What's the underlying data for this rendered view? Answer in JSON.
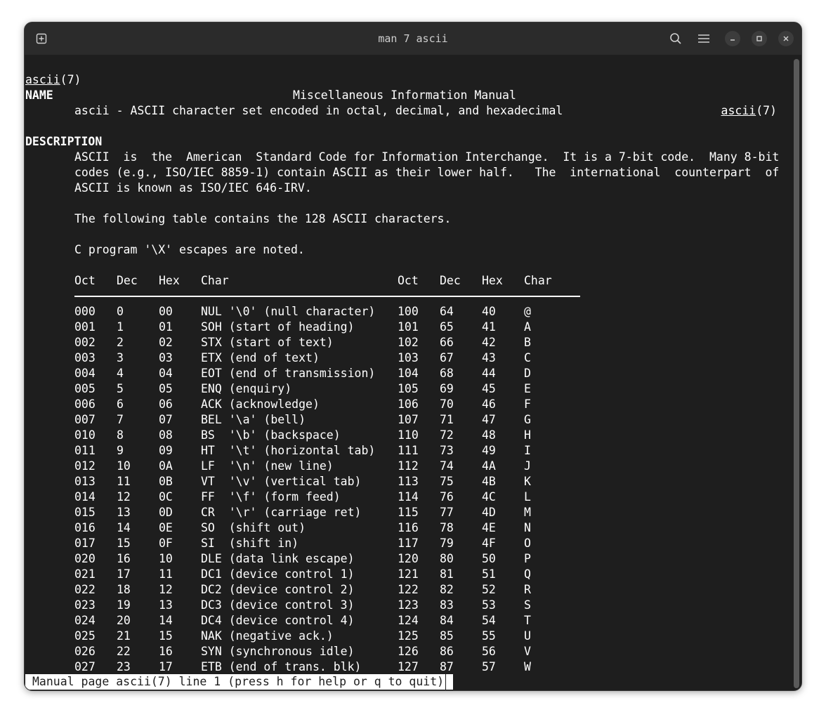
{
  "window": {
    "title": "man 7 ascii"
  },
  "titlebar": {
    "new_tab_icon": "new-tab-icon",
    "search_icon": "search-icon",
    "menu_icon": "hamburger-menu-icon",
    "minimize_icon": "minimize-icon",
    "maximize_icon": "maximize-icon",
    "close_icon": "close-icon"
  },
  "man": {
    "header_left": "ascii",
    "header_left_suffix": "(7)",
    "header_center": "Miscellaneous Information Manual",
    "header_right": "ascii",
    "header_right_suffix": "(7)",
    "name_heading": "NAME",
    "name_text": "ascii - ASCII character set encoded in octal, decimal, and hexadecimal",
    "description_heading": "DESCRIPTION",
    "desc_line1": "ASCII  is  the  American  Standard Code for Information Interchange.  It is a 7-bit code.  Many 8-bit",
    "desc_line2": "codes (e.g., ISO/IEC 8859-1) contain ASCII as their lower half.   The  international  counterpart  of",
    "desc_line3": "ASCII is known as ISO/IEC 646-IRV.",
    "table_intro": "The following table contains the 128 ASCII characters.",
    "escapes_note": "C program '\\X' escapes are noted."
  },
  "table": {
    "headers": [
      "Oct",
      "Dec",
      "Hex",
      "Char",
      "Oct",
      "Dec",
      "Hex",
      "Char"
    ],
    "rows": [
      [
        "000",
        "0",
        "00",
        "NUL '\\0' (null character)",
        "100",
        "64",
        "40",
        "@"
      ],
      [
        "001",
        "1",
        "01",
        "SOH (start of heading)",
        "101",
        "65",
        "41",
        "A"
      ],
      [
        "002",
        "2",
        "02",
        "STX (start of text)",
        "102",
        "66",
        "42",
        "B"
      ],
      [
        "003",
        "3",
        "03",
        "ETX (end of text)",
        "103",
        "67",
        "43",
        "C"
      ],
      [
        "004",
        "4",
        "04",
        "EOT (end of transmission)",
        "104",
        "68",
        "44",
        "D"
      ],
      [
        "005",
        "5",
        "05",
        "ENQ (enquiry)",
        "105",
        "69",
        "45",
        "E"
      ],
      [
        "006",
        "6",
        "06",
        "ACK (acknowledge)",
        "106",
        "70",
        "46",
        "F"
      ],
      [
        "007",
        "7",
        "07",
        "BEL '\\a' (bell)",
        "107",
        "71",
        "47",
        "G"
      ],
      [
        "010",
        "8",
        "08",
        "BS  '\\b' (backspace)",
        "110",
        "72",
        "48",
        "H"
      ],
      [
        "011",
        "9",
        "09",
        "HT  '\\t' (horizontal tab)",
        "111",
        "73",
        "49",
        "I"
      ],
      [
        "012",
        "10",
        "0A",
        "LF  '\\n' (new line)",
        "112",
        "74",
        "4A",
        "J"
      ],
      [
        "013",
        "11",
        "0B",
        "VT  '\\v' (vertical tab)",
        "113",
        "75",
        "4B",
        "K"
      ],
      [
        "014",
        "12",
        "0C",
        "FF  '\\f' (form feed)",
        "114",
        "76",
        "4C",
        "L"
      ],
      [
        "015",
        "13",
        "0D",
        "CR  '\\r' (carriage ret)",
        "115",
        "77",
        "4D",
        "M"
      ],
      [
        "016",
        "14",
        "0E",
        "SO  (shift out)",
        "116",
        "78",
        "4E",
        "N"
      ],
      [
        "017",
        "15",
        "0F",
        "SI  (shift in)",
        "117",
        "79",
        "4F",
        "O"
      ],
      [
        "020",
        "16",
        "10",
        "DLE (data link escape)",
        "120",
        "80",
        "50",
        "P"
      ],
      [
        "021",
        "17",
        "11",
        "DC1 (device control 1)",
        "121",
        "81",
        "51",
        "Q"
      ],
      [
        "022",
        "18",
        "12",
        "DC2 (device control 2)",
        "122",
        "82",
        "52",
        "R"
      ],
      [
        "023",
        "19",
        "13",
        "DC3 (device control 3)",
        "123",
        "83",
        "53",
        "S"
      ],
      [
        "024",
        "20",
        "14",
        "DC4 (device control 4)",
        "124",
        "84",
        "54",
        "T"
      ],
      [
        "025",
        "21",
        "15",
        "NAK (negative ack.)",
        "125",
        "85",
        "55",
        "U"
      ],
      [
        "026",
        "22",
        "16",
        "SYN (synchronous idle)",
        "126",
        "86",
        "56",
        "V"
      ],
      [
        "027",
        "23",
        "17",
        "ETB (end of trans. blk)",
        "127",
        "87",
        "57",
        "W"
      ]
    ]
  },
  "status": {
    "prompt": "Manual page ascii(7) line 1 (press h for help or q to quit)"
  }
}
